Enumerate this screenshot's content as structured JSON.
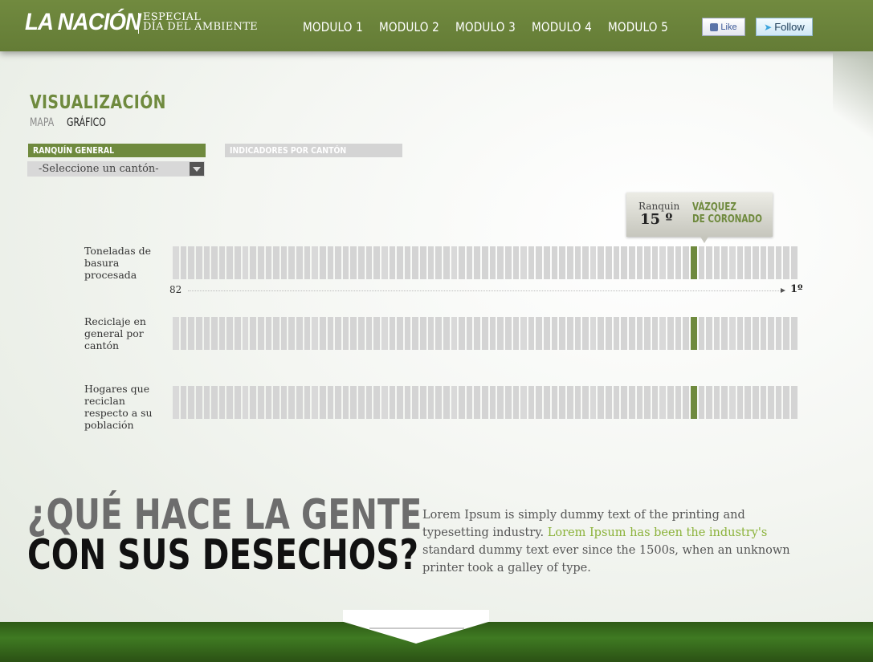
{
  "header": {
    "logo": "LA NACIÓN",
    "subtitle_line1": "ESPECIAL",
    "subtitle_line2": "DÍA DEL AMBIENTE",
    "nav": [
      "MODULO 1",
      "MODULO 2",
      "MODULO 3",
      "MODULO 4",
      "MODULO 5"
    ],
    "like_label": "Like",
    "follow_label": "Follow"
  },
  "visualization": {
    "title": "VISUALIZACIÓN",
    "tabs": {
      "map": "MAPA",
      "chart": "GRÁFICO",
      "active": "chart"
    },
    "ranking_tab": "RANQUÍN GENERAL",
    "indicators_tab": "INDICADORES POR CANTÓN",
    "select_value": "-Seleccione un cantón-"
  },
  "tooltip": {
    "label": "Ranquin",
    "value": "15 º",
    "name_line1": "VÁZQUEZ",
    "name_line2": "DE CORONADO"
  },
  "rows": [
    {
      "label": "Toneladas de basura procesada"
    },
    {
      "label": "Reciclaje en general por cantón"
    },
    {
      "label": "Hogares que reciclan respecto a su población"
    }
  ],
  "axis": {
    "left": "82",
    "right": "1º"
  },
  "chart_data": {
    "type": "bar",
    "segments": 81,
    "highlight_rank": 15,
    "rank_range": [
      82,
      1
    ]
  },
  "question": {
    "line1": "¿QUÉ HACE LA GENTE",
    "line2": "CON SUS DESECHOS?",
    "text_before": "Lorem Ipsum is simply dummy text of the printing and typesetting industry. ",
    "text_highlight": "Lorem Ipsum has been the industry's",
    "text_after": " standard dummy text ever since the 1500s, when an unknown printer took a galley of type."
  },
  "colors": {
    "accent": "#6f8a3e",
    "header": "#6b8439",
    "segment": "#d4d4d4",
    "link": "#8bb23a"
  }
}
